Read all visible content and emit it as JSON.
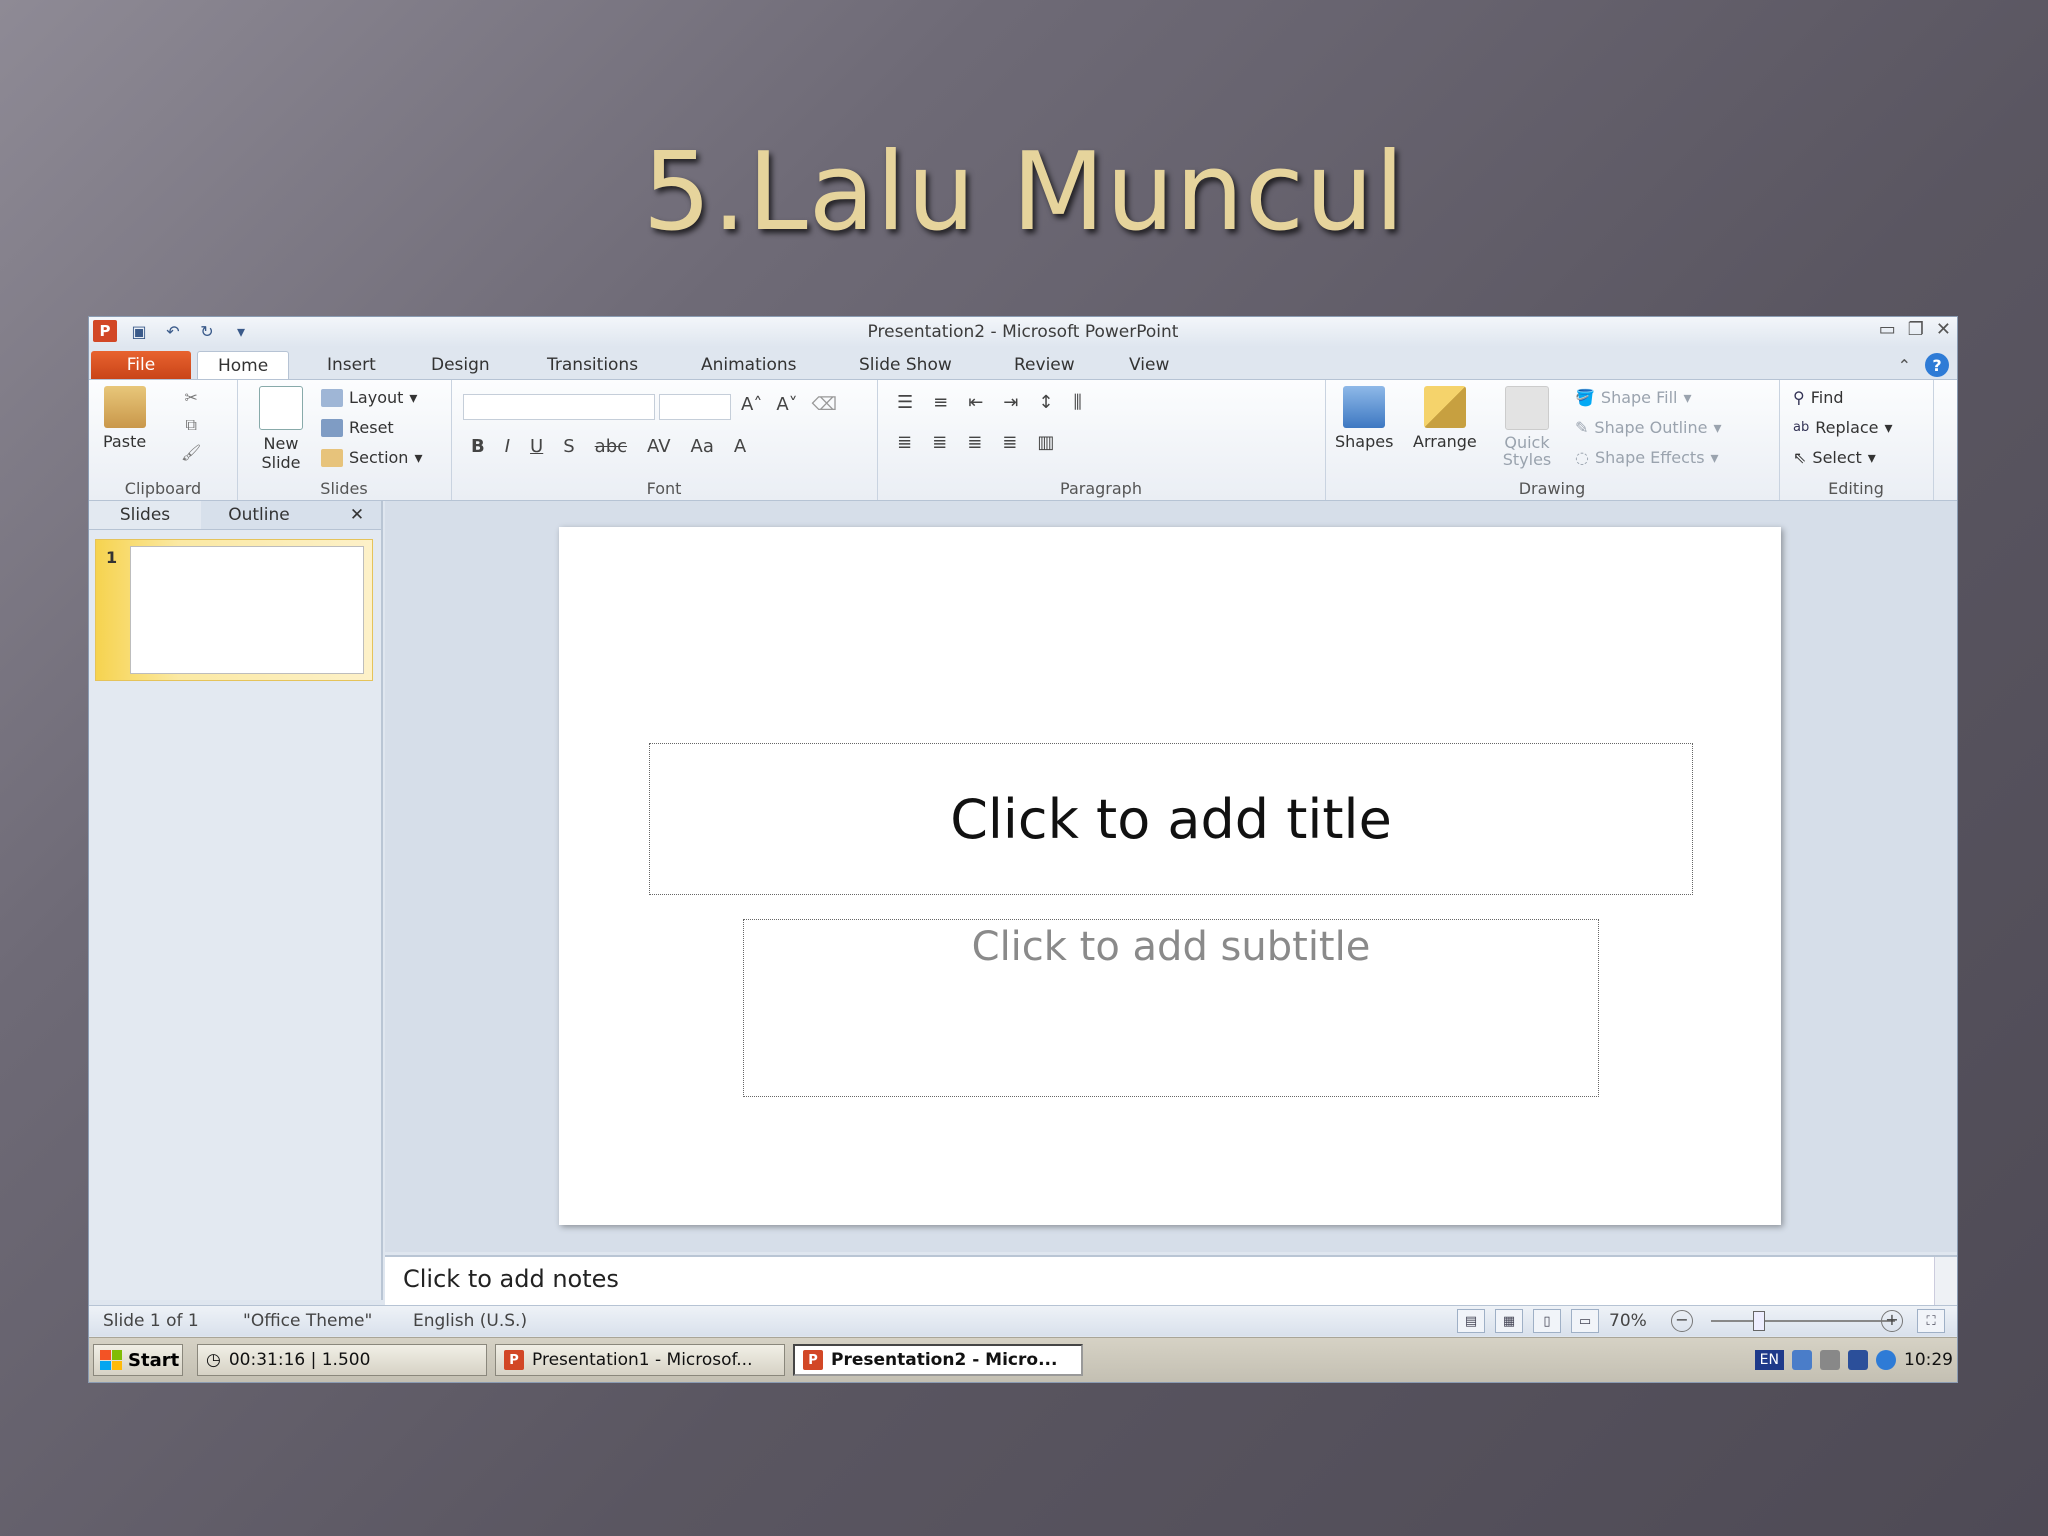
{
  "slide": {
    "title": "5.Lalu Muncul"
  },
  "window": {
    "title": "Presentation2 - Microsoft PowerPoint",
    "tabs": [
      "File",
      "Home",
      "Insert",
      "Design",
      "Transitions",
      "Animations",
      "Slide Show",
      "Review",
      "View"
    ],
    "active_tab": "Home"
  },
  "ribbon": {
    "clipboard": {
      "paste": "Paste",
      "label": "Clipboard"
    },
    "slides": {
      "new_slide": "New Slide",
      "layout": "Layout",
      "reset": "Reset",
      "section": "Section",
      "label": "Slides"
    },
    "font": {
      "label": "Font",
      "bold": "B",
      "italic": "I",
      "underline": "U",
      "shadow": "S",
      "strike": "abc",
      "spacing": "AV",
      "case": "Aa",
      "color": "A"
    },
    "paragraph": {
      "label": "Paragraph"
    },
    "drawing": {
      "shapes": "Shapes",
      "arrange": "Arrange",
      "quick_styles": "Quick Styles",
      "shape_fill": "Shape Fill",
      "shape_outline": "Shape Outline",
      "shape_effects": "Shape Effects",
      "label": "Drawing"
    },
    "editing": {
      "find": "Find",
      "replace": "Replace",
      "select": "Select",
      "label": "Editing"
    }
  },
  "left_pane": {
    "tabs": [
      "Slides",
      "Outline"
    ],
    "slide_number": "1"
  },
  "canvas": {
    "title_placeholder": "Click to add title",
    "subtitle_placeholder": "Click to add subtitle"
  },
  "notes": {
    "placeholder": "Click to add notes"
  },
  "status_bar": {
    "slide": "Slide 1 of 1",
    "theme": "\"Office Theme\"",
    "language": "English (U.S.)",
    "zoom": "70%"
  },
  "taskbar": {
    "start": "Start",
    "items": [
      "00:31:16 | 1.500",
      "Presentation1 - Microsof...",
      "Presentation2 - Micro..."
    ],
    "lang": "EN",
    "clock": "10:29"
  },
  "colors": {
    "file_tab": "#d24726",
    "title_text": "#e6d49c"
  }
}
